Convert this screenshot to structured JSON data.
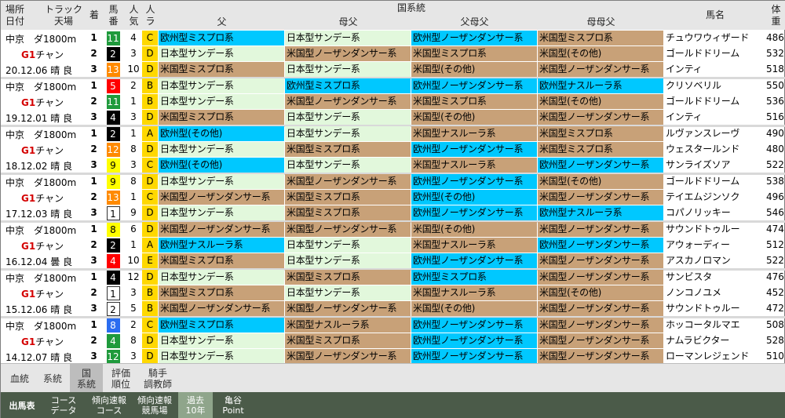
{
  "header": {
    "place_date": "場所\n日付",
    "track": "トラック\n天場",
    "chaku": "着",
    "umaban": "馬\n番",
    "ninki": "人\n気",
    "ra": "人\nラ",
    "group": "国系統",
    "chichi": "父",
    "hahachichi": "母父",
    "chichihahachichi": "父母父",
    "hahahahachichi": "母母父",
    "bamei": "馬名",
    "taiju": "体\n重"
  },
  "colors": {
    "pale_green": "#e2f8dc",
    "cyan": "#00c8ff",
    "tan": "#c8a178",
    "waku_white": "#ffffff",
    "waku_black": "#000000",
    "waku_red": "#ff0000",
    "waku_blue": "#2b6df0",
    "waku_yellow": "#ffff00",
    "waku_green": "#1f9a3c",
    "waku_orange": "#ff8a00",
    "waku_pink": "#ffb0d0",
    "ra_yellow": "#ffd800"
  },
  "races": [
    {
      "venue": "中京　ダ1800m",
      "grade": "G1",
      "racename": "チャン",
      "date_cond": "20.12.06 晴 良",
      "rows": [
        {
          "rank": "1",
          "umaban": "11",
          "waku": "green",
          "ninki": "4",
          "ra": "C",
          "sire": [
            "欧州型ミスプロ系",
            "cyan"
          ],
          "bms": [
            "日本型サンデー系",
            "pale_green"
          ],
          "sbms": [
            "欧州型ノーザンダンサー系",
            "cyan"
          ],
          "bbms": [
            "米国型ミスプロ系",
            "tan"
          ],
          "name": "チュウワウィザード",
          "weight": "486"
        },
        {
          "rank": "2",
          "umaban": "2",
          "waku": "black",
          "ninki": "3",
          "ra": "D",
          "sire": [
            "日本型サンデー系",
            "pale_green"
          ],
          "bms": [
            "米国型ノーザンダンサー系",
            "tan"
          ],
          "sbms": [
            "米国型ミスプロ系",
            "tan"
          ],
          "bbms": [
            "米国型(その他)",
            "tan"
          ],
          "name": "ゴールドドリーム",
          "weight": "532"
        },
        {
          "rank": "3",
          "umaban": "13",
          "waku": "orange",
          "ninki": "10",
          "ra": "D",
          "sire": [
            "米国型ミスプロ系",
            "tan"
          ],
          "bms": [
            "日本型サンデー系",
            "pale_green"
          ],
          "sbms": [
            "米国型(その他)",
            "tan"
          ],
          "bbms": [
            "米国型ノーザンダンサー系",
            "tan"
          ],
          "name": "インティ",
          "weight": "518"
        }
      ]
    },
    {
      "venue": "中京　ダ1800m",
      "grade": "G1",
      "racename": "チャン",
      "date_cond": "19.12.01 晴 良",
      "rows": [
        {
          "rank": "1",
          "umaban": "5",
          "waku": "red",
          "ninki": "2",
          "ra": "B",
          "sire": [
            "日本型サンデー系",
            "pale_green"
          ],
          "bms": [
            "欧州型ミスプロ系",
            "cyan"
          ],
          "sbms": [
            "欧州型ノーザンダンサー系",
            "cyan"
          ],
          "bbms": [
            "欧州型ナスルーラ系",
            "cyan"
          ],
          "name": "クリソベリル",
          "weight": "550"
        },
        {
          "rank": "2",
          "umaban": "11",
          "waku": "green",
          "ninki": "1",
          "ra": "B",
          "sire": [
            "日本型サンデー系",
            "pale_green"
          ],
          "bms": [
            "米国型ノーザンダンサー系",
            "tan"
          ],
          "sbms": [
            "米国型ミスプロ系",
            "tan"
          ],
          "bbms": [
            "米国型(その他)",
            "tan"
          ],
          "name": "ゴールドドリーム",
          "weight": "536"
        },
        {
          "rank": "3",
          "umaban": "4",
          "waku": "black",
          "ninki": "3",
          "ra": "D",
          "sire": [
            "米国型ミスプロ系",
            "tan"
          ],
          "bms": [
            "日本型サンデー系",
            "pale_green"
          ],
          "sbms": [
            "米国型(その他)",
            "tan"
          ],
          "bbms": [
            "米国型ノーザンダンサー系",
            "tan"
          ],
          "name": "インティ",
          "weight": "516"
        }
      ]
    },
    {
      "venue": "中京　ダ1800m",
      "grade": "G1",
      "racename": "チャン",
      "date_cond": "18.12.02 晴 良",
      "rows": [
        {
          "rank": "1",
          "umaban": "2",
          "waku": "black",
          "ninki": "1",
          "ra": "A",
          "sire": [
            "欧州型(その他)",
            "cyan"
          ],
          "bms": [
            "日本型サンデー系",
            "pale_green"
          ],
          "sbms": [
            "米国型ナスルーラ系",
            "tan"
          ],
          "bbms": [
            "米国型ミスプロ系",
            "tan"
          ],
          "name": "ルヴァンスレーヴ",
          "weight": "490"
        },
        {
          "rank": "2",
          "umaban": "12",
          "waku": "orange",
          "ninki": "8",
          "ra": "D",
          "sire": [
            "日本型サンデー系",
            "pale_green"
          ],
          "bms": [
            "米国型ミスプロ系",
            "tan"
          ],
          "sbms": [
            "欧州型ノーザンダンサー系",
            "cyan"
          ],
          "bbms": [
            "米国型ミスプロ系",
            "tan"
          ],
          "name": "ウェスタールンド",
          "weight": "480"
        },
        {
          "rank": "3",
          "umaban": "9",
          "waku": "yellow",
          "ninki": "3",
          "ra": "C",
          "sire": [
            "欧州型(その他)",
            "cyan"
          ],
          "bms": [
            "日本型サンデー系",
            "pale_green"
          ],
          "sbms": [
            "米国型ナスルーラ系",
            "tan"
          ],
          "bbms": [
            "欧州型ノーザンダンサー系",
            "cyan"
          ],
          "name": "サンライズソア",
          "weight": "522"
        }
      ]
    },
    {
      "venue": "中京　ダ1800m",
      "grade": "G1",
      "racename": "チャン",
      "date_cond": "17.12.03 晴 良",
      "rows": [
        {
          "rank": "1",
          "umaban": "9",
          "waku": "yellow",
          "ninki": "8",
          "ra": "D",
          "sire": [
            "日本型サンデー系",
            "pale_green"
          ],
          "bms": [
            "米国型ノーザンダンサー系",
            "tan"
          ],
          "sbms": [
            "欧州型ノーザンダンサー系",
            "cyan"
          ],
          "bbms": [
            "米国型(その他)",
            "tan"
          ],
          "name": "ゴールドドリーム",
          "weight": "538"
        },
        {
          "rank": "2",
          "umaban": "13",
          "waku": "orange",
          "ninki": "1",
          "ra": "C",
          "sire": [
            "米国型ノーザンダンサー系",
            "tan"
          ],
          "bms": [
            "米国型ミスプロ系",
            "tan"
          ],
          "sbms": [
            "欧州型(その他)",
            "cyan"
          ],
          "bbms": [
            "米国型ノーザンダンサー系",
            "tan"
          ],
          "name": "テイエムジンソク",
          "weight": "496"
        },
        {
          "rank": "3",
          "umaban": "1",
          "waku": "white",
          "ninki": "9",
          "ra": "D",
          "sire": [
            "日本型サンデー系",
            "pale_green"
          ],
          "bms": [
            "米国型ミスプロ系",
            "tan"
          ],
          "sbms": [
            "欧州型ノーザンダンサー系",
            "cyan"
          ],
          "bbms": [
            "欧州型ナスルーラ系",
            "cyan"
          ],
          "name": "コパノリッキー",
          "weight": "546"
        }
      ]
    },
    {
      "venue": "中京　ダ1800m",
      "grade": "G1",
      "racename": "チャン",
      "date_cond": "16.12.04 曇 良",
      "rows": [
        {
          "rank": "1",
          "umaban": "8",
          "waku": "yellow",
          "ninki": "6",
          "ra": "D",
          "sire": [
            "米国型ノーザンダンサー系",
            "tan"
          ],
          "bms": [
            "米国型ノーザンダンサー系",
            "tan"
          ],
          "sbms": [
            "米国型(その他)",
            "tan"
          ],
          "bbms": [
            "米国型ノーザンダンサー系",
            "tan"
          ],
          "name": "サウンドトゥルー",
          "weight": "474"
        },
        {
          "rank": "2",
          "umaban": "2",
          "waku": "black",
          "ninki": "1",
          "ra": "A",
          "sire": [
            "欧州型ナスルーラ系",
            "cyan"
          ],
          "bms": [
            "日本型サンデー系",
            "pale_green"
          ],
          "sbms": [
            "米国型ナスルーラ系",
            "tan"
          ],
          "bbms": [
            "欧州型ノーザンダンサー系",
            "cyan"
          ],
          "name": "アウォーディー",
          "weight": "512"
        },
        {
          "rank": "3",
          "umaban": "4",
          "waku": "red",
          "ninki": "10",
          "ra": "E",
          "sire": [
            "米国型ミスプロ系",
            "tan"
          ],
          "bms": [
            "日本型サンデー系",
            "pale_green"
          ],
          "sbms": [
            "欧州型ノーザンダンサー系",
            "cyan"
          ],
          "bbms": [
            "米国型ノーザンダンサー系",
            "tan"
          ],
          "name": "アスカノロマン",
          "weight": "522"
        }
      ]
    },
    {
      "venue": "中京　ダ1800m",
      "grade": "G1",
      "racename": "チャン",
      "date_cond": "15.12.06 晴 良",
      "rows": [
        {
          "rank": "1",
          "umaban": "4",
          "waku": "black",
          "ninki": "12",
          "ra": "D",
          "sire": [
            "日本型サンデー系",
            "pale_green"
          ],
          "bms": [
            "米国型ミスプロ系",
            "tan"
          ],
          "sbms": [
            "欧州型ミスプロ系",
            "cyan"
          ],
          "bbms": [
            "米国型ノーザンダンサー系",
            "tan"
          ],
          "name": "サンビスタ",
          "weight": "476"
        },
        {
          "rank": "2",
          "umaban": "1",
          "waku": "white",
          "ninki": "3",
          "ra": "B",
          "sire": [
            "米国型ミスプロ系",
            "tan"
          ],
          "bms": [
            "日本型サンデー系",
            "pale_green"
          ],
          "sbms": [
            "米国型ナスルーラ系",
            "tan"
          ],
          "bbms": [
            "米国型(その他)",
            "tan"
          ],
          "name": "ノンコノユメ",
          "weight": "452"
        },
        {
          "rank": "3",
          "umaban": "2",
          "waku": "white",
          "ninki": "5",
          "ra": "B",
          "sire": [
            "米国型ノーザンダンサー系",
            "tan"
          ],
          "bms": [
            "米国型ノーザンダンサー系",
            "tan"
          ],
          "sbms": [
            "米国型(その他)",
            "tan"
          ],
          "bbms": [
            "米国型ノーザンダンサー系",
            "tan"
          ],
          "name": "サウンドトゥルー",
          "weight": "472"
        }
      ]
    },
    {
      "venue": "中京　ダ1800m",
      "grade": "G1",
      "racename": "チャン",
      "date_cond": "14.12.07 晴 良",
      "rows": [
        {
          "rank": "1",
          "umaban": "8",
          "waku": "blue",
          "ninki": "2",
          "ra": "C",
          "sire": [
            "欧州型ミスプロ系",
            "cyan"
          ],
          "bms": [
            "米国型ナスルーラ系",
            "tan"
          ],
          "sbms": [
            "欧州型ノーザンダンサー系",
            "cyan"
          ],
          "bbms": [
            "米国型ノーザンダンサー系",
            "tan"
          ],
          "name": "ホッコータルマエ",
          "weight": "508"
        },
        {
          "rank": "2",
          "umaban": "4",
          "waku": "green",
          "ninki": "8",
          "ra": "D",
          "sire": [
            "日本型サンデー系",
            "pale_green"
          ],
          "bms": [
            "米国型ミスプロ系",
            "tan"
          ],
          "sbms": [
            "欧州型ノーザンダンサー系",
            "cyan"
          ],
          "bbms": [
            "米国型ノーザンダンサー系",
            "tan"
          ],
          "name": "ナムラビクター",
          "weight": "528"
        },
        {
          "rank": "3",
          "umaban": "12",
          "waku": "green",
          "ninki": "3",
          "ra": "D",
          "sire": [
            "日本型サンデー系",
            "pale_green"
          ],
          "bms": [
            "米国型ノーザンダンサー系",
            "tan"
          ],
          "sbms": [
            "欧州型ノーザンダンサー系",
            "cyan"
          ],
          "bbms": [
            "米国型ノーザンダンサー系",
            "tan"
          ],
          "name": "ローマンレジェンド",
          "weight": "510"
        }
      ]
    }
  ],
  "tabs_row1": [
    {
      "label": "血統",
      "active": false
    },
    {
      "label": "系統",
      "active": false
    },
    {
      "label": "国\n系統",
      "active": true
    },
    {
      "label": "評価\n順位",
      "active": false
    },
    {
      "label": "騎手\n調教師",
      "active": false
    }
  ],
  "tabs_row2": [
    {
      "label": "出馬表",
      "active": false
    },
    {
      "label": "コース\nデータ",
      "active": false
    },
    {
      "label": "傾向速報\nコース",
      "active": false
    },
    {
      "label": "傾向速報\n競馬場",
      "active": false
    },
    {
      "label": "過去\n10年",
      "active": true
    },
    {
      "label": "亀谷\nPoint",
      "active": false
    }
  ]
}
